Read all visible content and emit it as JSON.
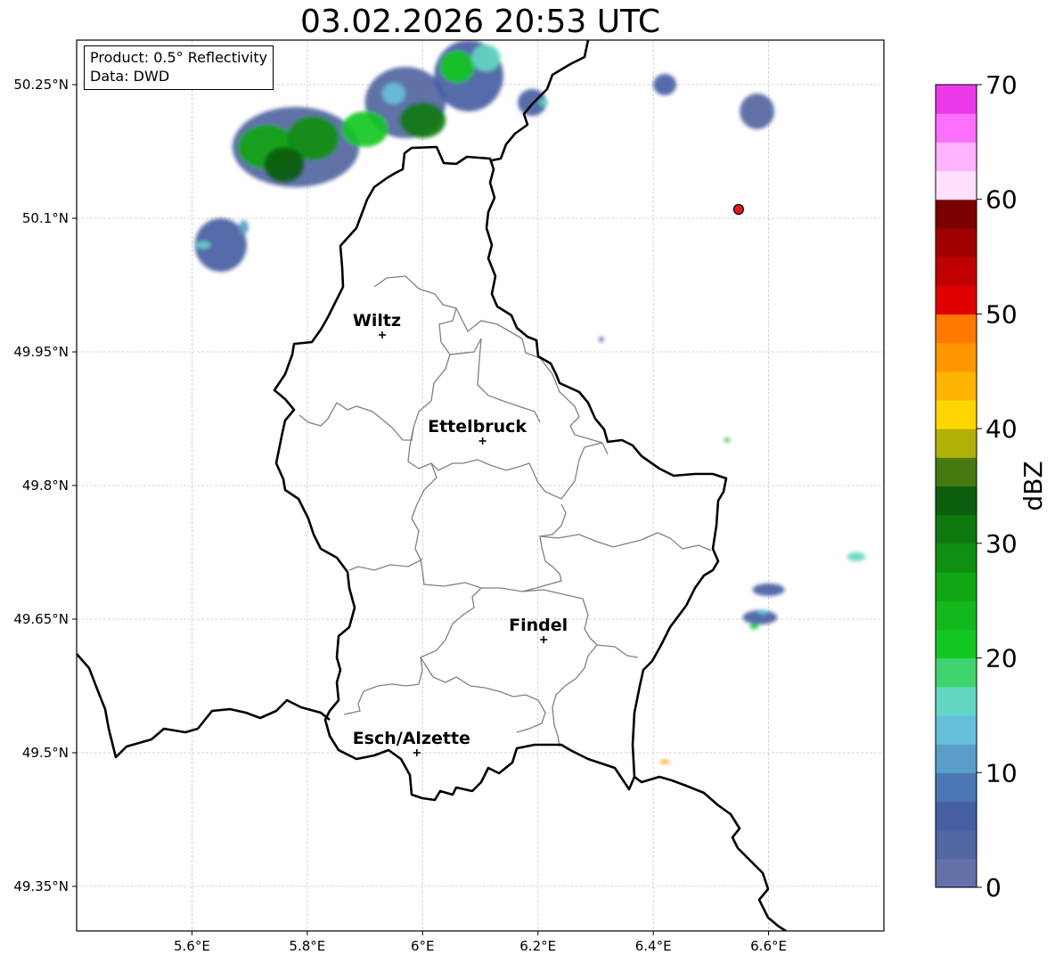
{
  "title": "03.02.2026 20:53 UTC",
  "info": {
    "product": "Product: 0.5° Reflectivity",
    "data": "Data: DWD"
  },
  "map": {
    "lon_range": [
      5.4,
      6.8
    ],
    "lat_range": [
      49.3,
      50.3
    ],
    "lon_ticks": [
      {
        "value": 5.6,
        "label": "5.6°E"
      },
      {
        "value": 5.8,
        "label": "5.8°E"
      },
      {
        "value": 6.0,
        "label": "6°E"
      },
      {
        "value": 6.2,
        "label": "6.2°E"
      },
      {
        "value": 6.4,
        "label": "6.4°E"
      },
      {
        "value": 6.6,
        "label": "6.6°E"
      }
    ],
    "lat_ticks": [
      {
        "value": 50.25,
        "label": "50.25°N"
      },
      {
        "value": 50.1,
        "label": "50.1°N"
      },
      {
        "value": 49.95,
        "label": "49.95°N"
      },
      {
        "value": 49.8,
        "label": "49.8°N"
      },
      {
        "value": 49.65,
        "label": "49.65°N"
      },
      {
        "value": 49.5,
        "label": "49.5°N"
      },
      {
        "value": 49.35,
        "label": "49.35°N"
      }
    ],
    "grid": true
  },
  "cities": [
    {
      "name": "Wiltz",
      "lon": 5.93,
      "lat": 49.969
    },
    {
      "name": "Ettelbruck",
      "lon": 6.104,
      "lat": 49.85
    },
    {
      "name": "Findel",
      "lon": 6.21,
      "lat": 49.627
    },
    {
      "name": "Esch/Alzette",
      "lon": 5.99,
      "lat": 49.5
    }
  ],
  "radar_site": {
    "lon": 6.548,
    "lat": 50.11,
    "color": "#e41a1c"
  },
  "colorbar": {
    "label": "dBZ",
    "min": 0,
    "max": 70,
    "step": 2.5,
    "ticks": [
      {
        "value": 0,
        "label": "0"
      },
      {
        "value": 10,
        "label": "10"
      },
      {
        "value": 20,
        "label": "20"
      },
      {
        "value": 30,
        "label": "30"
      },
      {
        "value": 40,
        "label": "40"
      },
      {
        "value": 50,
        "label": "50"
      },
      {
        "value": 60,
        "label": "60"
      },
      {
        "value": 70,
        "label": "70"
      }
    ],
    "colors": [
      "#6371a8",
      "#5266a0",
      "#465fa3",
      "#4a78b2",
      "#5a9ec8",
      "#66c0dc",
      "#63d6c3",
      "#40d46e",
      "#13c722",
      "#12b81c",
      "#10a512",
      "#0e8f11",
      "#0d7a10",
      "#0b5e0d",
      "#467a10",
      "#b0b107",
      "#ffd600",
      "#ffb400",
      "#ff9600",
      "#ff7800",
      "#e00000",
      "#c00000",
      "#a00000",
      "#7a0000",
      "#ffe0ff",
      "#ffb4ff",
      "#ff6fff",
      "#ea3ae8"
    ]
  },
  "echoes": [
    {
      "lon": 5.78,
      "lat": 50.18,
      "rx": 0.11,
      "ry": 0.045,
      "dbz": 3
    },
    {
      "lon": 5.97,
      "lat": 50.23,
      "rx": 0.07,
      "ry": 0.04,
      "dbz": 3
    },
    {
      "lon": 6.08,
      "lat": 50.26,
      "rx": 0.06,
      "ry": 0.04,
      "dbz": 7
    },
    {
      "lon": 5.73,
      "lat": 50.18,
      "rx": 0.05,
      "ry": 0.025,
      "dbz": 25
    },
    {
      "lon": 5.81,
      "lat": 50.19,
      "rx": 0.045,
      "ry": 0.025,
      "dbz": 28
    },
    {
      "lon": 5.76,
      "lat": 50.16,
      "rx": 0.035,
      "ry": 0.02,
      "dbz": 33
    },
    {
      "lon": 5.9,
      "lat": 50.2,
      "rx": 0.04,
      "ry": 0.02,
      "dbz": 22
    },
    {
      "lon": 6.0,
      "lat": 50.21,
      "rx": 0.04,
      "ry": 0.02,
      "dbz": 30
    },
    {
      "lon": 6.06,
      "lat": 50.27,
      "rx": 0.03,
      "ry": 0.018,
      "dbz": 22
    },
    {
      "lon": 6.11,
      "lat": 50.28,
      "rx": 0.025,
      "ry": 0.015,
      "dbz": 15
    },
    {
      "lon": 5.95,
      "lat": 50.24,
      "rx": 0.02,
      "ry": 0.012,
      "dbz": 13
    },
    {
      "lon": 5.65,
      "lat": 50.07,
      "rx": 0.045,
      "ry": 0.03,
      "dbz": 5
    },
    {
      "lon": 5.62,
      "lat": 50.07,
      "rx": 0.012,
      "ry": 0.004,
      "dbz": 15
    },
    {
      "lon": 5.69,
      "lat": 50.09,
      "rx": 0.008,
      "ry": 0.008,
      "dbz": 12
    },
    {
      "lon": 6.19,
      "lat": 50.23,
      "rx": 0.025,
      "ry": 0.015,
      "dbz": 7
    },
    {
      "lon": 6.21,
      "lat": 50.23,
      "rx": 0.008,
      "ry": 0.004,
      "dbz": 15
    },
    {
      "lon": 6.58,
      "lat": 50.22,
      "rx": 0.03,
      "ry": 0.02,
      "dbz": 4
    },
    {
      "lon": 6.42,
      "lat": 50.25,
      "rx": 0.02,
      "ry": 0.012,
      "dbz": 5
    },
    {
      "lon": 6.31,
      "lat": 49.964,
      "rx": 0.004,
      "ry": 0.003,
      "dbz": 5
    },
    {
      "lon": 6.528,
      "lat": 49.851,
      "rx": 0.005,
      "ry": 0.002,
      "dbz": 25
    },
    {
      "lon": 6.752,
      "lat": 49.72,
      "rx": 0.016,
      "ry": 0.005,
      "dbz": 15
    },
    {
      "lon": 6.6,
      "lat": 49.683,
      "rx": 0.028,
      "ry": 0.007,
      "dbz": 5
    },
    {
      "lon": 6.585,
      "lat": 49.652,
      "rx": 0.03,
      "ry": 0.008,
      "dbz": 5
    },
    {
      "lon": 6.59,
      "lat": 49.658,
      "rx": 0.008,
      "ry": 0.003,
      "dbz": 14
    },
    {
      "lon": 6.575,
      "lat": 49.642,
      "rx": 0.008,
      "ry": 0.003,
      "dbz": 22
    },
    {
      "lon": 6.42,
      "lat": 49.49,
      "rx": 0.009,
      "ry": 0.002,
      "dbz": 45
    }
  ]
}
